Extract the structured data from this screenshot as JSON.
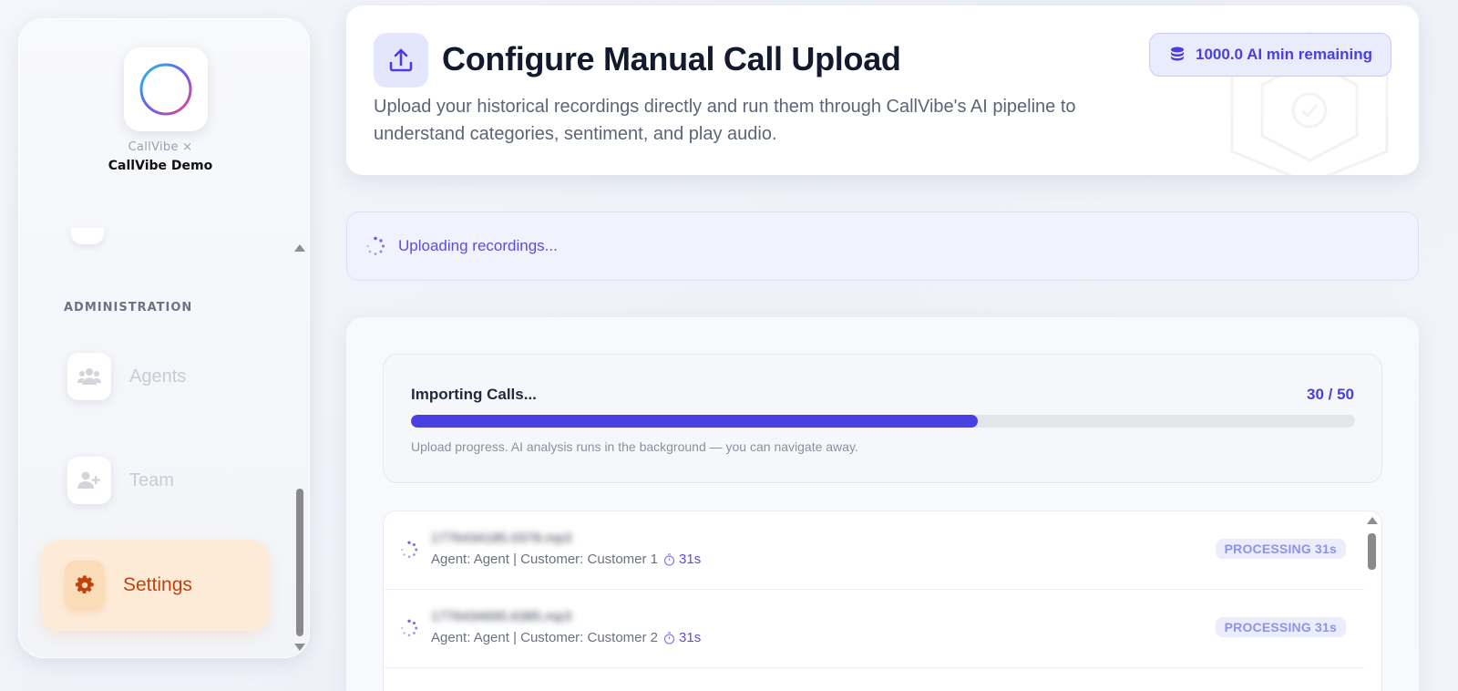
{
  "sidebar": {
    "brand_sub": "CallVibe ×",
    "brand_org": "CallVibe Demo",
    "section_label": "ADMINISTRATION",
    "items": [
      {
        "label": "Agents",
        "icon": "users-icon"
      },
      {
        "label": "Team",
        "icon": "user-plus-icon"
      },
      {
        "label": "Settings",
        "icon": "gear-icon",
        "active": true
      }
    ]
  },
  "header": {
    "title": "Configure Manual Call Upload",
    "description": "Upload your historical recordings directly and run them through CallVibe's AI pipeline to understand categories, sentiment, and play audio.",
    "credits": "1000.0 AI min remaining"
  },
  "status": {
    "text": "Uploading recordings..."
  },
  "progress": {
    "title": "Importing Calls...",
    "count": "30 / 50",
    "done": 30,
    "total": 50,
    "note": "Upload progress. AI analysis runs in the background — you can navigate away."
  },
  "files": [
    {
      "name": "1776434185.0378.mp3",
      "meta": "Agent: Agent | Customer: Customer 1",
      "duration": "31s",
      "status": "PROCESSING 31s"
    },
    {
      "name": "1776434695.6385.mp3",
      "meta": "Agent: Agent | Customer: Customer 2",
      "duration": "31s",
      "status": "PROCESSING 31s"
    }
  ],
  "colors": {
    "accent": "#4a3fe0",
    "settings_active": "#c2410c"
  }
}
